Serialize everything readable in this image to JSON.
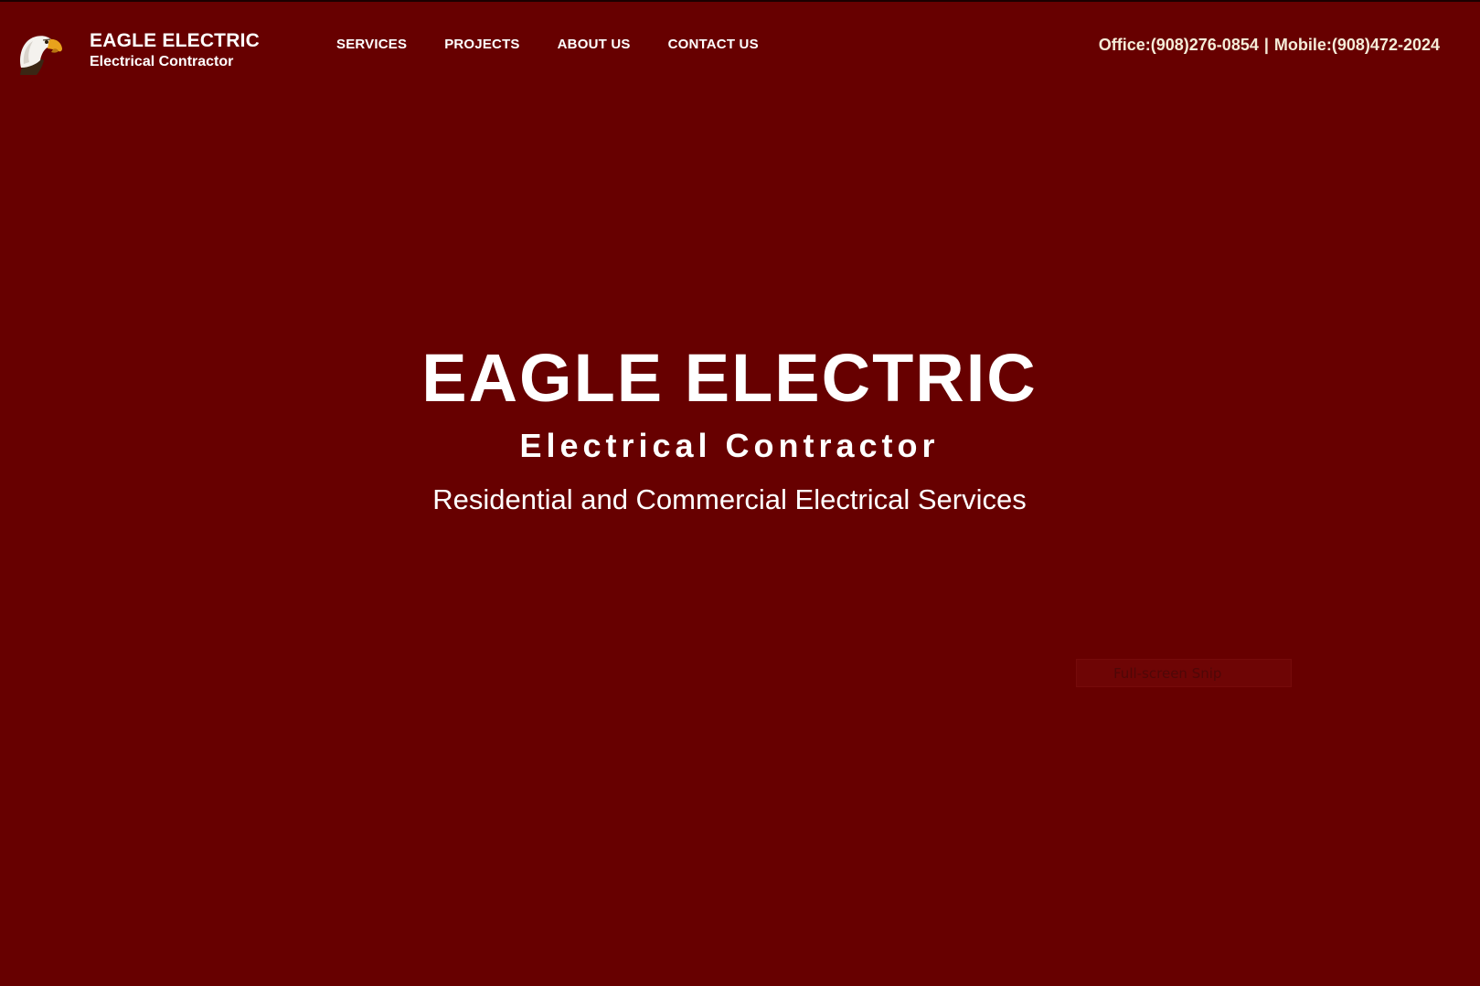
{
  "header": {
    "logo_icon": "eagle-head-icon",
    "brand_name": "EAGLE ELECTRIC",
    "brand_tagline": "Electrical Contractor",
    "nav": [
      {
        "label": "SERVICES"
      },
      {
        "label": "PROJECTS"
      },
      {
        "label": "ABOUT US"
      },
      {
        "label": "CONTACT US"
      }
    ],
    "office_phone": "Office:(908)276-0854",
    "separator": "|",
    "mobile_phone": "Mobile:(908)472-2024"
  },
  "hero": {
    "title": "EAGLE ELECTRIC",
    "subtitle": "Electrical Contractor",
    "description": "Residential and Commercial Electrical Services"
  },
  "overlay": {
    "snip_label": "Full-screen Snip"
  },
  "colors": {
    "background": "#670000",
    "text": "#ffffff",
    "phone_text": "#f5ecd8"
  }
}
